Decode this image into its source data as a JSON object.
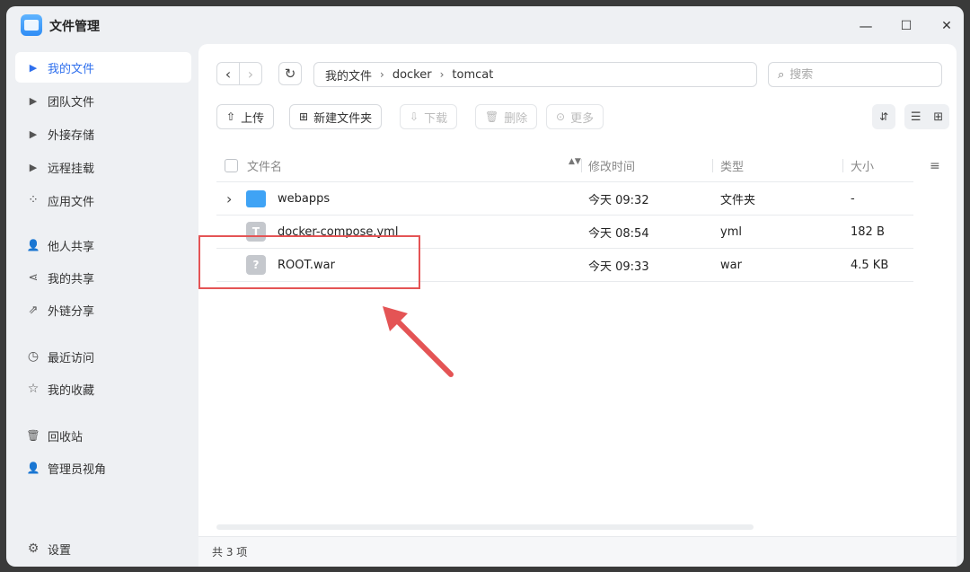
{
  "window": {
    "title": "文件管理",
    "controls": {
      "minimize": "—",
      "maximize": "☐",
      "close": "✕"
    }
  },
  "sidebar": {
    "items": [
      {
        "label": "我的文件",
        "icon": "caret-right-icon",
        "glyph": "▶",
        "active": true
      },
      {
        "label": "团队文件",
        "icon": "caret-right-icon",
        "glyph": "▶"
      },
      {
        "label": "外接存储",
        "icon": "caret-right-icon",
        "glyph": "▶"
      },
      {
        "label": "远程挂载",
        "icon": "caret-right-icon",
        "glyph": "▶"
      },
      {
        "label": "应用文件",
        "icon": "apps-icon",
        "glyph": "⁘"
      },
      {
        "label": "他人共享",
        "icon": "user-share-icon",
        "glyph": "👤"
      },
      {
        "label": "我的共享",
        "icon": "share-icon",
        "glyph": "⋖"
      },
      {
        "label": "外链分享",
        "icon": "external-link-icon",
        "glyph": "⇗"
      },
      {
        "label": "最近访问",
        "icon": "clock-icon",
        "glyph": "◷"
      },
      {
        "label": "我的收藏",
        "icon": "star-icon",
        "glyph": "☆"
      },
      {
        "label": "回收站",
        "icon": "trash-icon",
        "glyph": "🗑"
      },
      {
        "label": "管理员视角",
        "icon": "admin-icon",
        "glyph": "👤"
      }
    ],
    "settings_label": "设置",
    "settings_glyph": "⚙"
  },
  "navigation": {
    "back_glyph": "‹",
    "forward_glyph": "›",
    "refresh_glyph": "↻",
    "breadcrumb": [
      "我的文件",
      "docker",
      "tomcat"
    ],
    "breadcrumb_sep": "›"
  },
  "search": {
    "placeholder": "搜索",
    "glyph": "⌕"
  },
  "toolbar": {
    "upload": {
      "label": "上传",
      "glyph": "⇧"
    },
    "new_folder": {
      "label": "新建文件夹",
      "glyph": "⊞"
    },
    "download": {
      "label": "下载",
      "glyph": "⇩"
    },
    "delete": {
      "label": "删除",
      "glyph": "🗑"
    },
    "more": {
      "label": "更多",
      "glyph": "⊙"
    },
    "sort_glyph": "⇵",
    "list_view_glyph": "☰",
    "grid_view_glyph": "⊞"
  },
  "table": {
    "headers": {
      "name": "文件名",
      "modified": "修改时间",
      "type": "类型",
      "size": "大小"
    },
    "sort_glyph": "▲▼",
    "settings_glyph": "≡",
    "rows": [
      {
        "name": "webapps",
        "modified": "今天 09:32",
        "type": "文件夹",
        "size": "-",
        "kind": "folder",
        "expand": "›"
      },
      {
        "name": "docker-compose.yml",
        "modified": "今天 08:54",
        "type": "yml",
        "size": "182 B",
        "kind": "text",
        "icon_char": "T"
      },
      {
        "name": "ROOT.war",
        "modified": "今天 09:33",
        "type": "war",
        "size": "4.5 KB",
        "kind": "unknown",
        "icon_char": "?"
      }
    ]
  },
  "status": {
    "count": "共 3 项"
  },
  "annotation": {
    "color": "#e45455"
  },
  "colors": {
    "accent": "#2f6fed",
    "folder": "#3fa3f5"
  }
}
